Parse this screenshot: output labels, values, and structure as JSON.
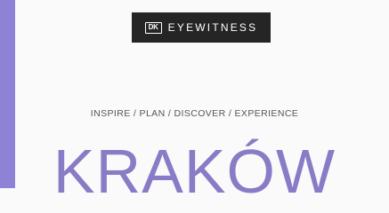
{
  "brand": {
    "logo_text": "DK",
    "name": "EYEWITNESS"
  },
  "tagline": "INSPIRE / PLAN / DISCOVER / EXPERIENCE",
  "title": "KRAKÓW",
  "colors": {
    "background_accent": "#8d82d6",
    "cover": "#fbfafb",
    "brand_bar": "#262525",
    "title": "#8a7bc6"
  }
}
